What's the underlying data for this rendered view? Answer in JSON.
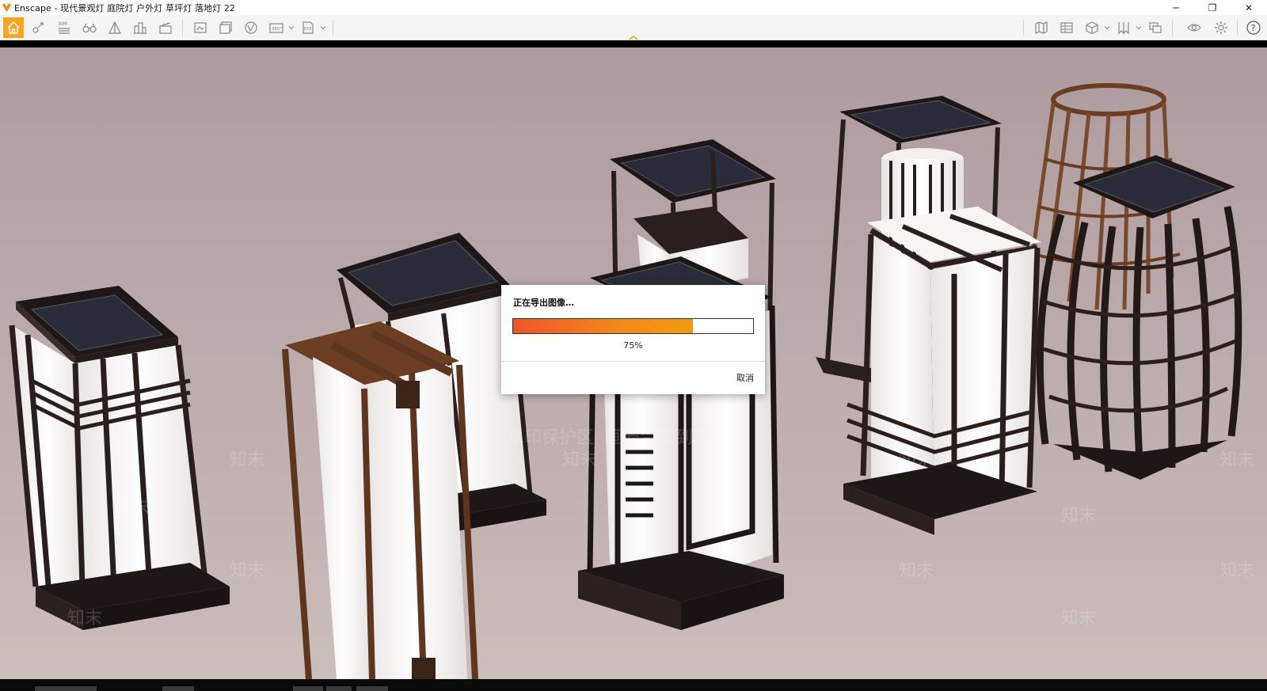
{
  "window": {
    "title": "Enscape - 现代景观灯 庭院灯 户外灯 草坪灯 落地灯  22",
    "minimize_glyph": "─",
    "maximize_glyph": "❐",
    "close_glyph": "✕"
  },
  "toolbar": {
    "bim_label": "BIM",
    "left_icons": [
      "home-icon",
      "location-pin-icon",
      "bim-icon",
      "binoculars-icon",
      "perspective-icon",
      "buildings-icon",
      "clapper-icon"
    ],
    "export_icons": [
      "screenshot-export-icon",
      "batch-render-icon",
      "vr-icon",
      "panorama-360-icon",
      "exe-export-icon"
    ],
    "right_icons": [
      "map-icon",
      "asset-library-icon",
      "box-view-icon",
      "bookmarks-icon",
      "collaborate-icon",
      "eye-visual-settings-icon",
      "gear-icon",
      "help-icon"
    ],
    "pano_label": "360°",
    "exe_label": "EXE",
    "help_glyph": "?"
  },
  "viewport": {
    "watermarks": [
      "水印保护区",
      "画质会受到影响",
      "知末"
    ]
  },
  "dialog": {
    "title": "正在导出图像…",
    "progress_percent": 75,
    "progress_text": "75%",
    "cancel_label": "取消"
  },
  "colors": {
    "accent_orange": "#f5a623",
    "progress_start": "#f0542a",
    "progress_end": "#f29a12"
  }
}
